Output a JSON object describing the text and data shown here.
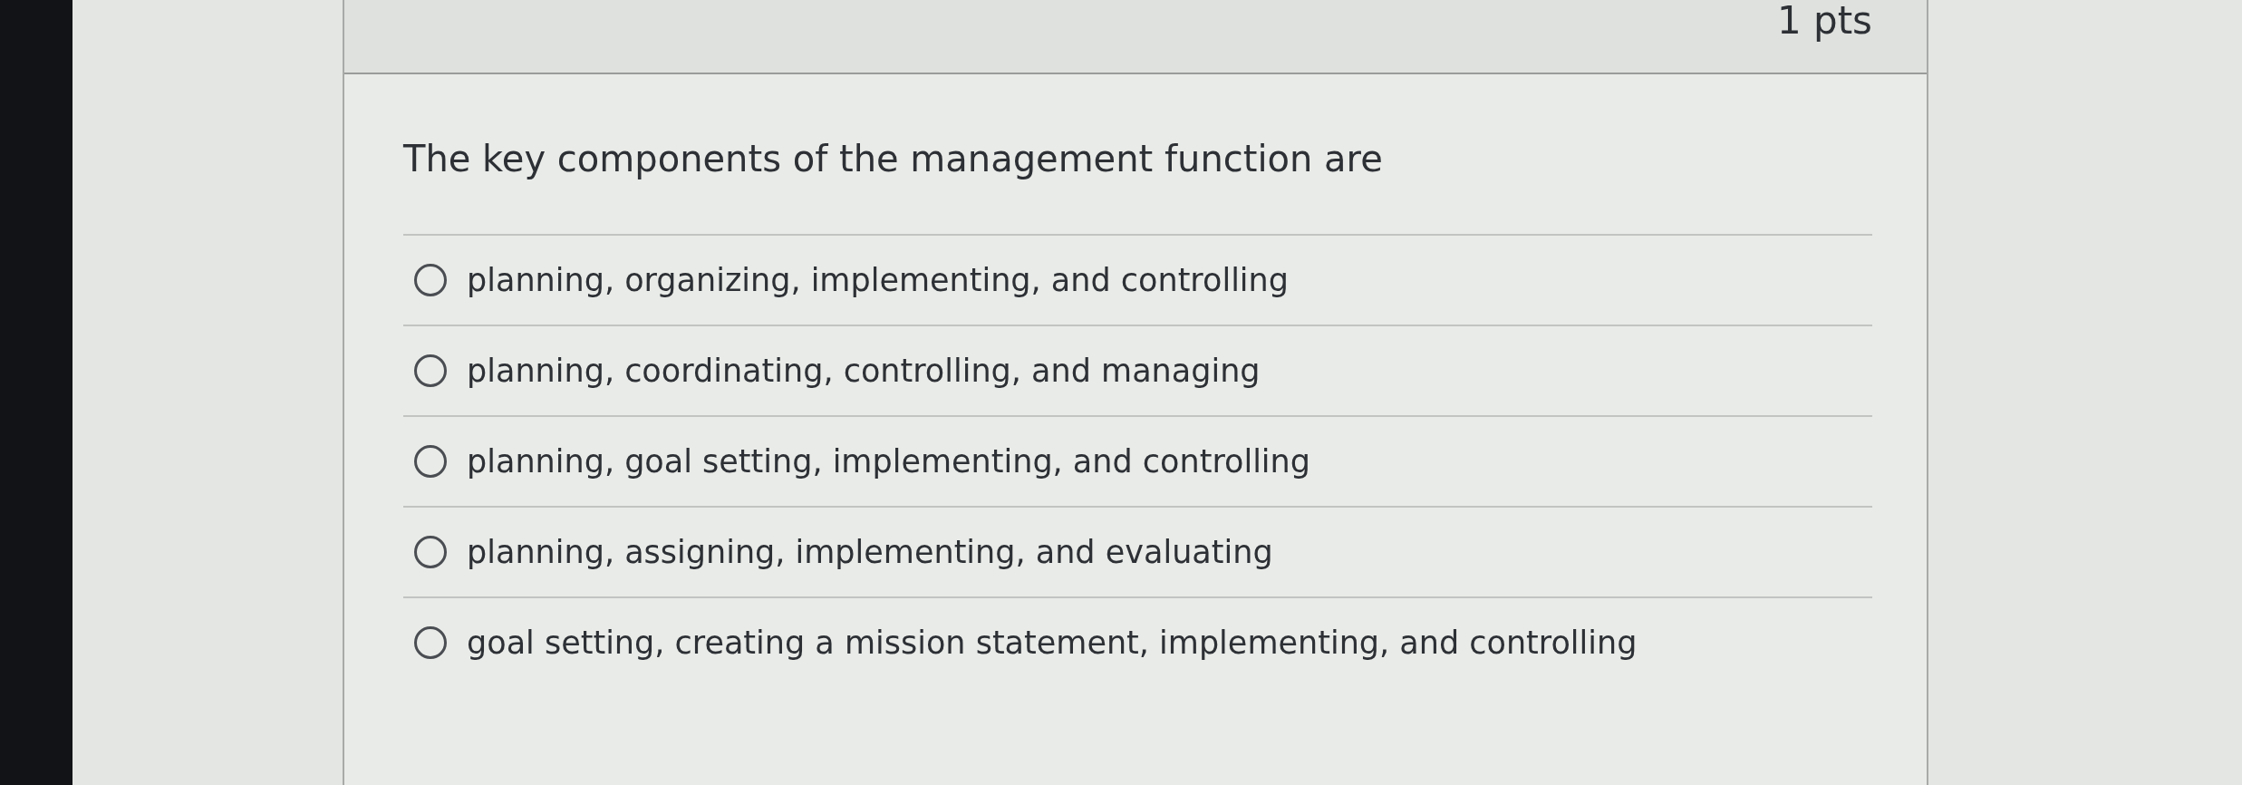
{
  "question": {
    "points": "1 pts",
    "text": "The key components of the management function are",
    "answers": [
      {
        "label": "planning, organizing, implementing, and controlling",
        "selected": false
      },
      {
        "label": "planning, coordinating, controlling, and managing",
        "selected": false
      },
      {
        "label": "planning, goal setting, implementing, and controlling",
        "selected": false
      },
      {
        "label": "planning, assigning, implementing, and evaluating",
        "selected": false
      },
      {
        "label": "goal setting, creating a mission statement, implementing, and controlling",
        "selected": false
      }
    ]
  }
}
